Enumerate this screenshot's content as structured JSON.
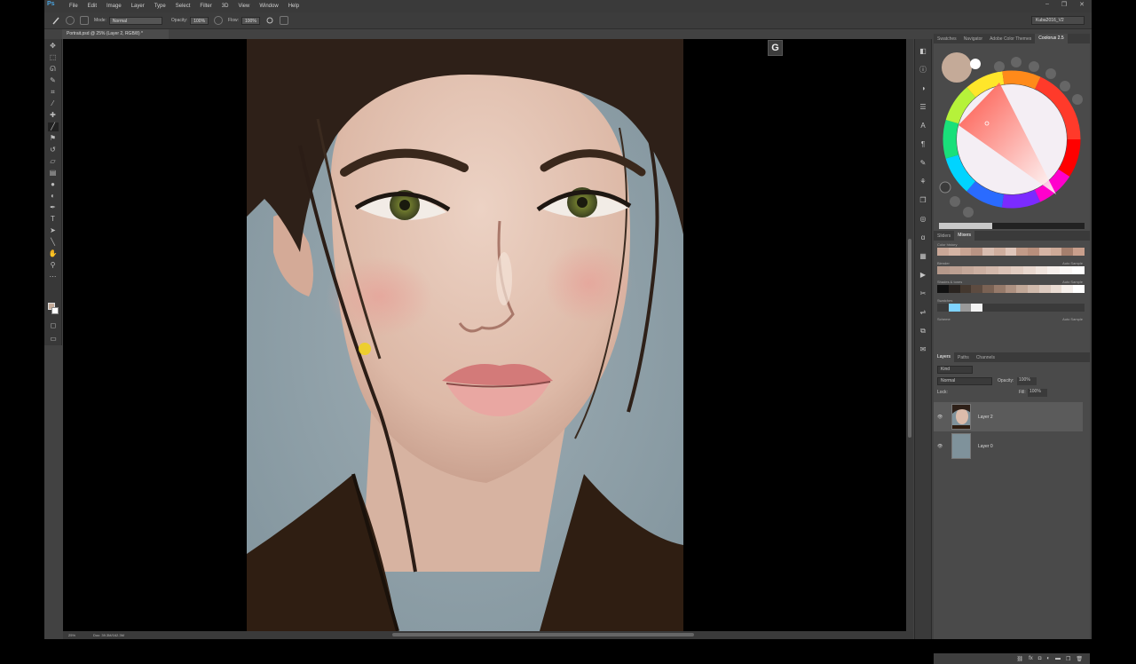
{
  "app": {
    "logo": "Ps",
    "menu": [
      "File",
      "Edit",
      "Image",
      "Layer",
      "Type",
      "Select",
      "Filter",
      "3D",
      "View",
      "Window",
      "Help"
    ],
    "window_buttons": [
      "–",
      "❐",
      "✕"
    ]
  },
  "options": {
    "mode_label": "Mode:",
    "mode_value": "Normal",
    "opacity_label": "Opacity:",
    "opacity_value": "100%",
    "flow_label": "Flow:",
    "flow_value": "100%",
    "workspace": "Kuba2016_V2"
  },
  "document": {
    "tab_title": "Portrait.psd @ 25% (Layer 2, RGB/8) *",
    "zoom": "25%",
    "doc_size": "Doc: 39.3M/162.3M",
    "g_badge": "G"
  },
  "color_panel": {
    "tabs": [
      "Swatches",
      "Navigator",
      "Adobe Color Themes",
      "Coolorus 2.5"
    ],
    "active_tab": "Coolorus 2.5",
    "current_color": "#c4aa98"
  },
  "mixers": {
    "tabs": [
      "Sliders",
      "Mixers"
    ],
    "active_tab": "Mixers",
    "color_history_label": "Color history",
    "blender_label": "Blender",
    "shades_label": "Shades & tones",
    "swatches_label": "Swatches",
    "scheme_label": "Scheme",
    "auto_sample": "Auto Sample",
    "history_colors": [
      "#c9a797",
      "#d4b4a4",
      "#c8a493",
      "#b99484",
      "#d8bdb0",
      "#cfae9e",
      "#e0c6ba",
      "#c29b88",
      "#b88f7c",
      "#d6b5a5",
      "#ceaa98",
      "#a57f6d",
      "#c99f8c"
    ],
    "blender_colors": [
      "#b5998b",
      "#bca092",
      "#c4a89a",
      "#ccb0a2",
      "#d3b9ac",
      "#dbc3b7",
      "#e2cdc2",
      "#e9d8cf",
      "#f0e4dd",
      "#f6efeb",
      "#fbf8f6",
      "#ffffff"
    ],
    "shade_colors": [
      "#111111",
      "#2a2420",
      "#44382f",
      "#5d4b40",
      "#7a6254",
      "#967a6a",
      "#ad9181",
      "#c1a898",
      "#d0baac",
      "#ddcbc0",
      "#eadcd3",
      "#f5efeb",
      "#ffffff"
    ],
    "swatch_colors": [
      "#3a3a3a",
      "#7fd3ff",
      "#9a9a9a",
      "#f3f3f3",
      "#3a3a3a",
      "#3a3a3a",
      "#3a3a3a",
      "#3a3a3a",
      "#3a3a3a",
      "#3a3a3a",
      "#3a3a3a",
      "#3a3a3a",
      "#3a3a3a"
    ]
  },
  "layers": {
    "tabs": [
      "Layers",
      "Paths",
      "Channels"
    ],
    "active_tab": "Layers",
    "filter_kind": "Kind",
    "blend_mode": "Normal",
    "opacity_label": "Opacity:",
    "opacity_value": "100%",
    "lock_label": "Lock:",
    "fill_label": "Fill:",
    "fill_value": "100%",
    "items": [
      {
        "name": "Layer 2",
        "selected": true
      },
      {
        "name": "Layer 0",
        "selected": false
      }
    ],
    "footer_icons": [
      "link-icon",
      "fx-icon",
      "mask-icon",
      "adjustment-icon",
      "group-icon",
      "new-layer-icon",
      "trash-icon"
    ]
  },
  "colors": {
    "app_bg": "#424242",
    "panel_bg": "#4a4a4a",
    "painting_bg": "#8d9ea6",
    "skin": "#e3c1b0",
    "hair": "#2e2018",
    "cursor": "#f0d21a"
  }
}
